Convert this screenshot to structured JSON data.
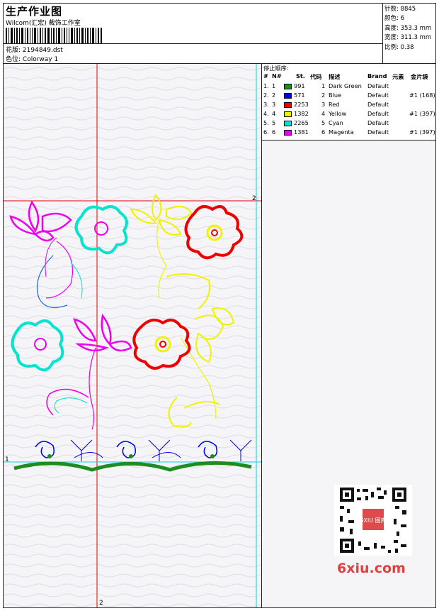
{
  "header": {
    "title": "生产作业图",
    "company": "Wilcom(汇宏) 裁饰工作室",
    "design_label": "花版:",
    "design_value": "2194849.dst",
    "color_label": "色位:",
    "color_value": "Colorway 1"
  },
  "stats": [
    {
      "label": "针数:",
      "value": "8845"
    },
    {
      "label": "颜色:",
      "value": "6"
    },
    {
      "label": "高度:",
      "value": "353.3 mm"
    },
    {
      "label": "宽度:",
      "value": "311.3 mm"
    },
    {
      "label": "比例:",
      "value": "0.38"
    }
  ],
  "stop_table": {
    "title": "停止顺序:",
    "columns": [
      "#",
      "N#",
      "St.",
      "代码",
      "描述",
      "Brand",
      "元素",
      "金片袋"
    ],
    "rows": [
      {
        "n": "1.",
        "nn": "1",
        "color": "#1e8c1e",
        "st": "991",
        "code": "1",
        "desc": "Dark Green",
        "brand": "Default",
        "elem": ""
      },
      {
        "n": "2.",
        "nn": "2",
        "color": "#0000ee",
        "st": "571",
        "code": "2",
        "desc": "Blue",
        "brand": "Default",
        "elem": "#1 (168)"
      },
      {
        "n": "3.",
        "nn": "3",
        "color": "#ee0000",
        "st": "2253",
        "code": "3",
        "desc": "Red",
        "brand": "Default",
        "elem": ""
      },
      {
        "n": "4.",
        "nn": "4",
        "color": "#f2f200",
        "st": "1382",
        "code": "4",
        "desc": "Yellow",
        "brand": "Default",
        "elem": "#1 (397)"
      },
      {
        "n": "5.",
        "nn": "5",
        "color": "#00e5d0",
        "st": "2265",
        "code": "5",
        "desc": "Cyan",
        "brand": "Default",
        "elem": ""
      },
      {
        "n": "6.",
        "nn": "6",
        "color": "#ee00ee",
        "st": "1381",
        "code": "6",
        "desc": "Magenta",
        "brand": "Default",
        "elem": "#1 (397)"
      }
    ]
  },
  "markers": {
    "top_right": "2",
    "left": "1",
    "bottom": "2"
  },
  "watermark": "6xiu.com",
  "qr_stamp": "6XIU 图库"
}
